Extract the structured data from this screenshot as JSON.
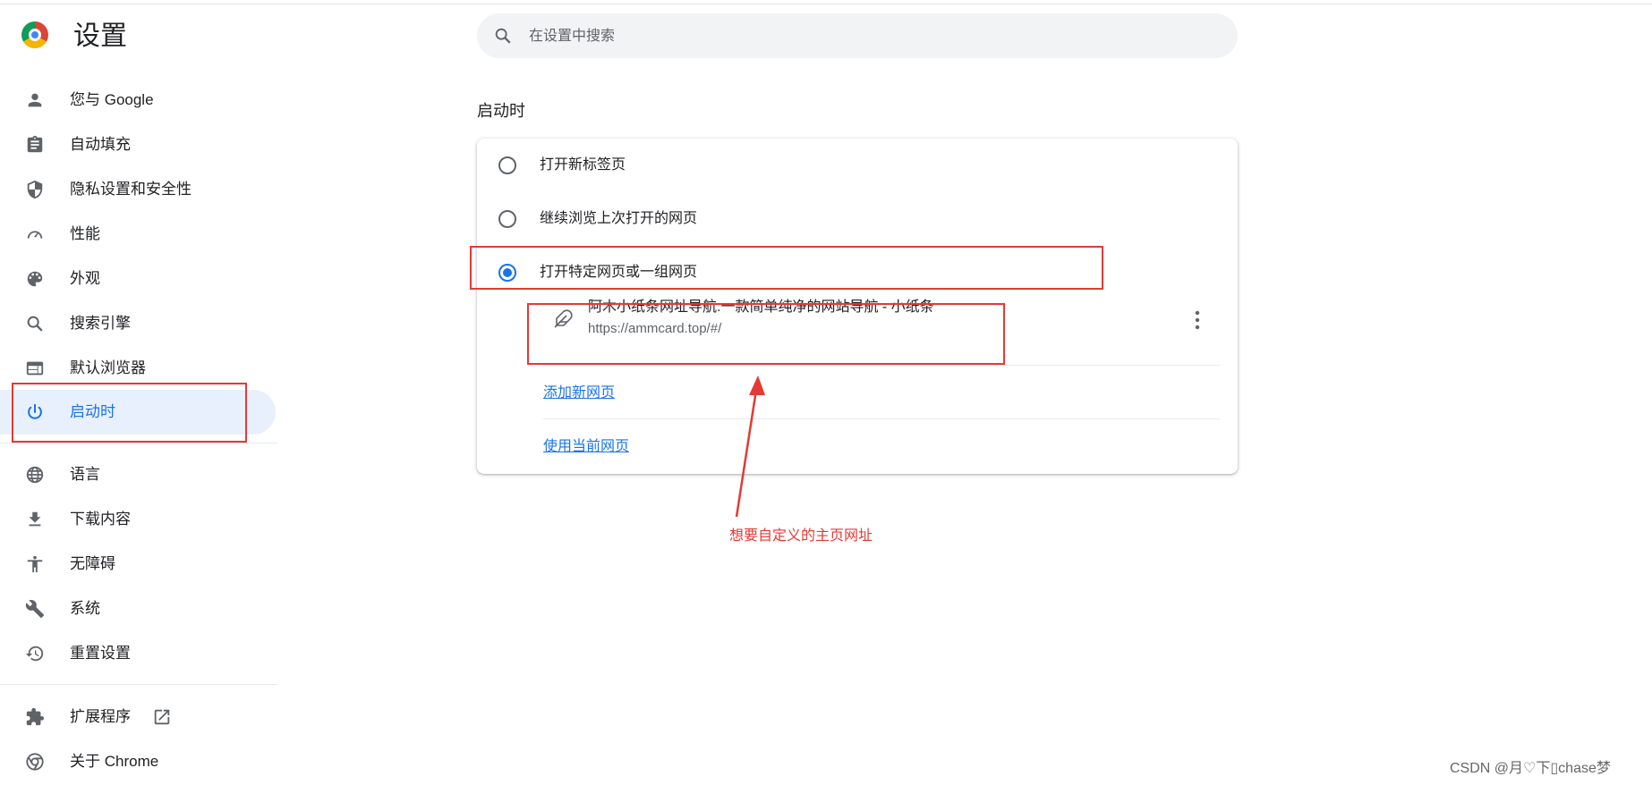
{
  "app": {
    "title": "设置"
  },
  "search": {
    "placeholder": "在设置中搜索"
  },
  "sidebar": {
    "items": [
      {
        "label": "您与 Google",
        "icon": "person-icon"
      },
      {
        "label": "自动填充",
        "icon": "clipboard-icon"
      },
      {
        "label": "隐私设置和安全性",
        "icon": "shield-icon"
      },
      {
        "label": "性能",
        "icon": "speedometer-icon"
      },
      {
        "label": "外观",
        "icon": "palette-icon"
      },
      {
        "label": "搜索引擎",
        "icon": "search-icon"
      },
      {
        "label": "默认浏览器",
        "icon": "browser-window-icon"
      },
      {
        "label": "启动时",
        "icon": "power-icon",
        "active": true
      },
      {
        "label": "语言",
        "icon": "globe-icon"
      },
      {
        "label": "下载内容",
        "icon": "download-icon"
      },
      {
        "label": "无障碍",
        "icon": "accessibility-icon"
      },
      {
        "label": "系统",
        "icon": "wrench-icon"
      },
      {
        "label": "重置设置",
        "icon": "history-icon"
      },
      {
        "label": "扩展程序",
        "icon": "puzzle-icon"
      },
      {
        "label": "关于 Chrome",
        "icon": "chrome-icon"
      }
    ]
  },
  "startup": {
    "section_title": "启动时",
    "options": [
      {
        "label": "打开新标签页",
        "checked": false
      },
      {
        "label": "继续浏览上次打开的网页",
        "checked": false
      },
      {
        "label": "打开特定网页或一组网页",
        "checked": true
      }
    ],
    "page": {
      "title": "阿木小纸条网址导航:一款简单纯净的网站导航 - 小纸条",
      "url": "https://ammcard.top/#/"
    },
    "add_page_link": "添加新网页",
    "use_current_link": "使用当前网页"
  },
  "annotation": {
    "text": "想要自定义的主页网址",
    "color": "#e53935"
  },
  "watermark": "CSDN @月♡下▯chase梦",
  "colors": {
    "accent": "#1a73e8",
    "active_bg": "#e8f0fe",
    "highlight": "#e53935"
  }
}
